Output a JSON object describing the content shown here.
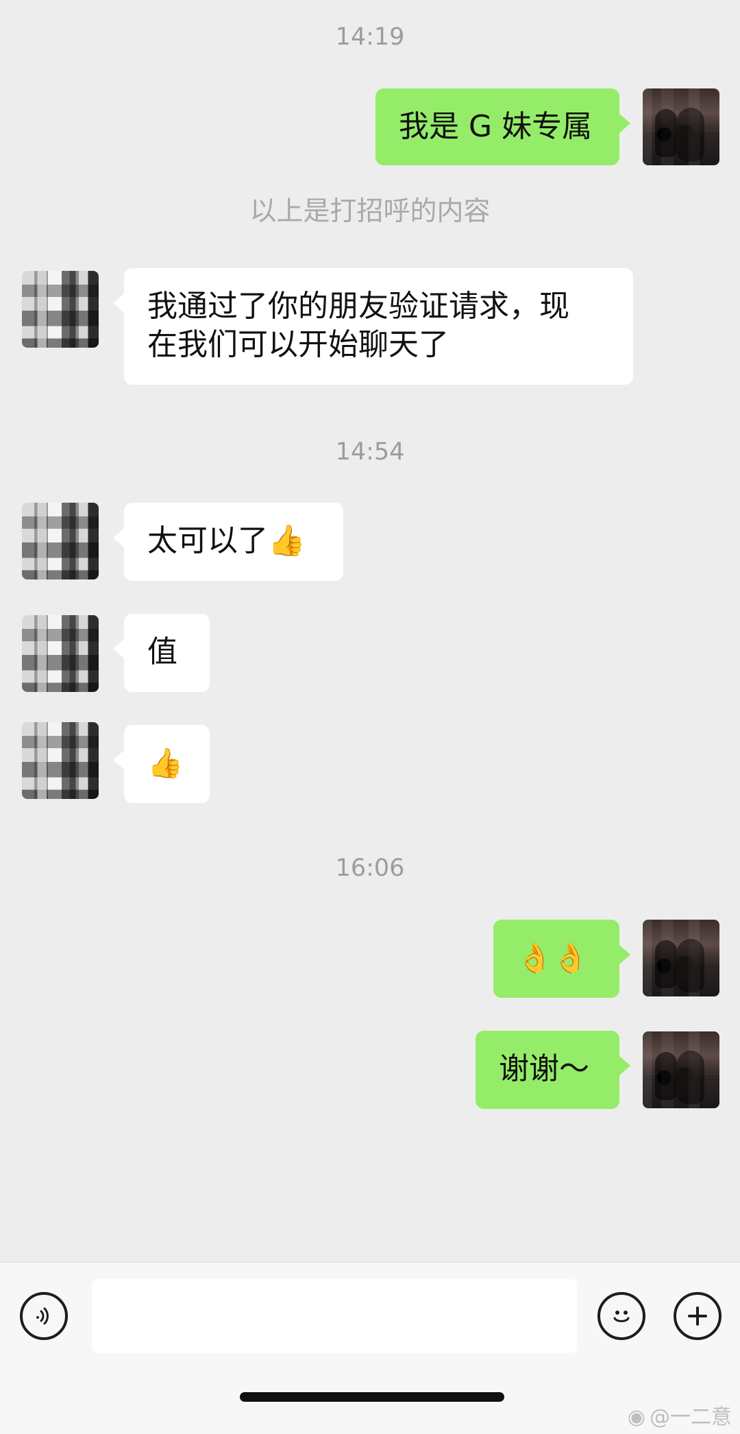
{
  "chat": {
    "timestamps": [
      "14:19",
      "14:54",
      "16:06"
    ],
    "system_note": "以上是打招呼的内容",
    "messages": [
      {
        "text": "我是 G 妹专属"
      },
      {
        "text": "我通过了你的朋友验证请求，现\n在我们可以开始聊天了"
      },
      {
        "text": "太可以了👍"
      },
      {
        "text": "值"
      },
      {
        "text": "👍"
      },
      {
        "text": "👌👌"
      },
      {
        "text": "谢谢～"
      }
    ]
  },
  "composer": {
    "placeholder": ""
  },
  "watermark": {
    "icon": "weibo-icon",
    "text": "@一二意"
  },
  "colors": {
    "background": "#ededed",
    "sent_bubble": "#95ec69",
    "received_bubble": "#ffffff"
  }
}
